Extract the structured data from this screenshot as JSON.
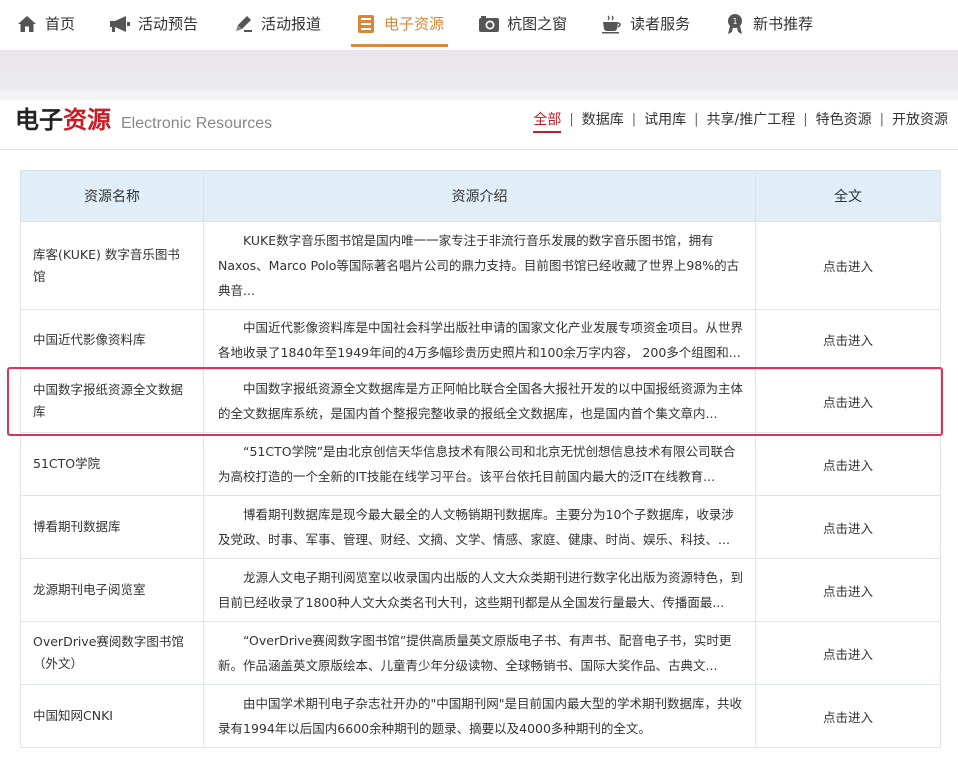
{
  "nav": {
    "items": [
      {
        "label": "首页",
        "icon": "home-icon"
      },
      {
        "label": "活动预告",
        "icon": "megaphone-icon"
      },
      {
        "label": "活动报道",
        "icon": "pen-icon"
      },
      {
        "label": "电子资源",
        "icon": "database-icon"
      },
      {
        "label": "杭图之窗",
        "icon": "camera-icon"
      },
      {
        "label": "读者服务",
        "icon": "coffee-icon"
      },
      {
        "label": "新书推荐",
        "icon": "medal-icon"
      }
    ],
    "active": "电子资源",
    "accent": "#d9873a"
  },
  "section": {
    "title_part1": "电子",
    "title_part2": "资源",
    "title_en": "Electronic Resources",
    "tabs": [
      "全部",
      "数据库",
      "试用库",
      "共享/推广工程",
      "特色资源",
      "开放资源"
    ],
    "active_tab": "全部",
    "red": "#c81d25"
  },
  "table": {
    "headers": [
      "资源名称",
      "资源介绍",
      "全文"
    ],
    "rows": [
      {
        "name": "库客(KUKE) 数字音乐图书馆",
        "desc": "KUKE数字音乐图书馆是国内唯一一家专注于非流行音乐发展的数字音乐图书馆，拥有Naxos、Marco Polo等国际著名唱片公司的鼎力支持。目前图书馆已经收藏了世界上98%的古典音...",
        "link": "点击进入"
      },
      {
        "name": "中国近代影像资料库",
        "desc": "中国近代影像资料库是中国社会科学出版社申请的国家文化产业发展专项资金项目。从世界各地收录了1840年至1949年间的4万多幅珍贵历史照片和100余万字内容， 200多个组图和...",
        "link": "点击进入"
      },
      {
        "name": "中国数字报纸资源全文数据库",
        "desc": "中国数字报纸资源全文数据库是方正阿帕比联合全国各大报社开发的以中国报纸资源为主体的全文数据库系统，是国内首个整报完整收录的报纸全文数据库，也是国内首个集文章内...",
        "link": "点击进入"
      },
      {
        "name": "51CTO学院",
        "desc": "“51CTO学院”是由北京创信天华信息技术有限公司和北京无忧创想信息技术有限公司联合为高校打造的一个全新的IT技能在线学习平台。该平台依托目前国内最大的泛IT在线教育...",
        "link": "点击进入"
      },
      {
        "name": "博看期刊数据库",
        "desc": "博看期刊数据库是现今最大最全的人文畅销期刊数据库。主要分为10个子数据库，收录涉及党政、时事、军事、管理、财经、文摘、文学、情感、家庭、健康、时尚、娱乐、科技、...",
        "link": "点击进入"
      },
      {
        "name": "龙源期刊电子阅览室",
        "desc": "龙源人文电子期刊阅览室以收录国内出版的人文大众类期刊进行数字化出版为资源特色，到目前已经收录了1800种人文大众类名刊大刊，这些期刊都是从全国发行量最大、传播面最...",
        "link": "点击进入"
      },
      {
        "name": "OverDrive赛阅数字图书馆（外文）",
        "desc": "“OverDrive赛阅数字图书馆”提供高质量英文原版电子书、有声书、配音电子书，实时更新。作品涵盖英文原版绘本、儿童青少年分级读物、全球畅销书、国际大奖作品、古典文...",
        "link": "点击进入"
      },
      {
        "name": "中国知网CNKI",
        "desc": "由中国学术期刊电子杂志社开办的\"中国期刊网\"是目前国内最大型的学术期刊数据库，共收录有1994年以后国内6600余种期刊的题录、摘要以及4000多种期刊的全文。",
        "link": "点击进入"
      }
    ]
  }
}
